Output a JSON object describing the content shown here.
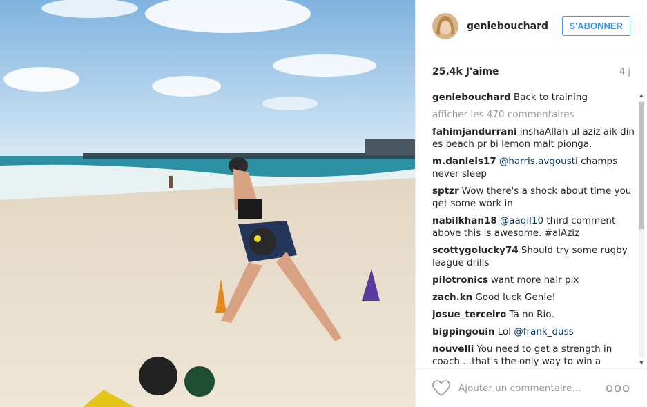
{
  "post": {
    "username": "geniebouchard",
    "follow_label": "S'ABONNER",
    "likes": "25.4k J'aime",
    "age": "4 j",
    "caption_author": "geniebouchard",
    "caption_text": "Back to training",
    "load_more": "afficher les 470 commentaires",
    "comments": [
      {
        "author": "fahimjandurrani",
        "text": "InshaAllah ul aziz aik din es beach pr bi lemon malt pionga.",
        "mention": ""
      },
      {
        "author": "m.daniels17",
        "mention": "@harris.avgousti",
        "text": " champs never sleep"
      },
      {
        "author": "sptzr",
        "text": "Wow there's a shock about time you get some work in",
        "mention": ""
      },
      {
        "author": "nabilkhan18",
        "mention": "@aaqil10",
        "text": " third comment above this is awesome. #alAziz"
      },
      {
        "author": "scottygolucky74",
        "text": "Should try some rugby league drills",
        "mention": ""
      },
      {
        "author": "pilotronics",
        "text": "want more hair pix",
        "mention": ""
      },
      {
        "author": "zach.kn",
        "text": "Good luck Genie!",
        "mention": ""
      },
      {
        "author": "josue_terceiro",
        "text": "Tá no Rio.",
        "mention": ""
      },
      {
        "author": "bigpingouin",
        "text": "Lol ",
        "mention": "@frank_duss"
      },
      {
        "author": "nouvelli",
        "text": "You need to get a strength in coach ...that's the only way to win a",
        "mention": ""
      }
    ],
    "add_comment_placeholder": "Ajouter un commentaire…",
    "more_icon": "ooo"
  }
}
